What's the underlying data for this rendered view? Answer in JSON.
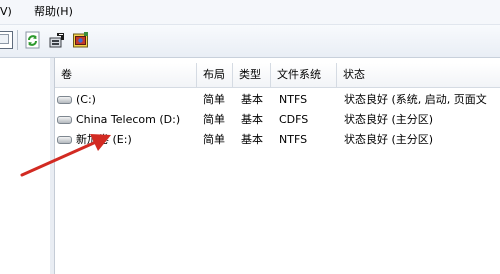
{
  "menubar": {
    "items": [
      {
        "label": "V)"
      },
      {
        "label": "帮助(H)"
      }
    ]
  },
  "toolbar": {
    "buttons": [
      "partial-window-icon",
      "refresh-icon",
      "properties-icon",
      "help-icon"
    ]
  },
  "table": {
    "columns": [
      "卷",
      "布局",
      "类型",
      "文件系统",
      "状态"
    ],
    "rows": [
      {
        "volume": "(C:)",
        "layout": "简单",
        "type": "基本",
        "fs": "NTFS",
        "status": "状态良好 (系统, 启动, 页面文"
      },
      {
        "volume": "China Telecom (D:)",
        "layout": "简单",
        "type": "基本",
        "fs": "CDFS",
        "status": "状态良好 (主分区)"
      },
      {
        "volume": "新加卷 (E:)",
        "layout": "简单",
        "type": "基本",
        "fs": "NTFS",
        "status": "状态良好 (主分区)"
      }
    ]
  },
  "colors": {
    "annotation_arrow": "#d22a22",
    "selection": "#cfe3f8"
  }
}
